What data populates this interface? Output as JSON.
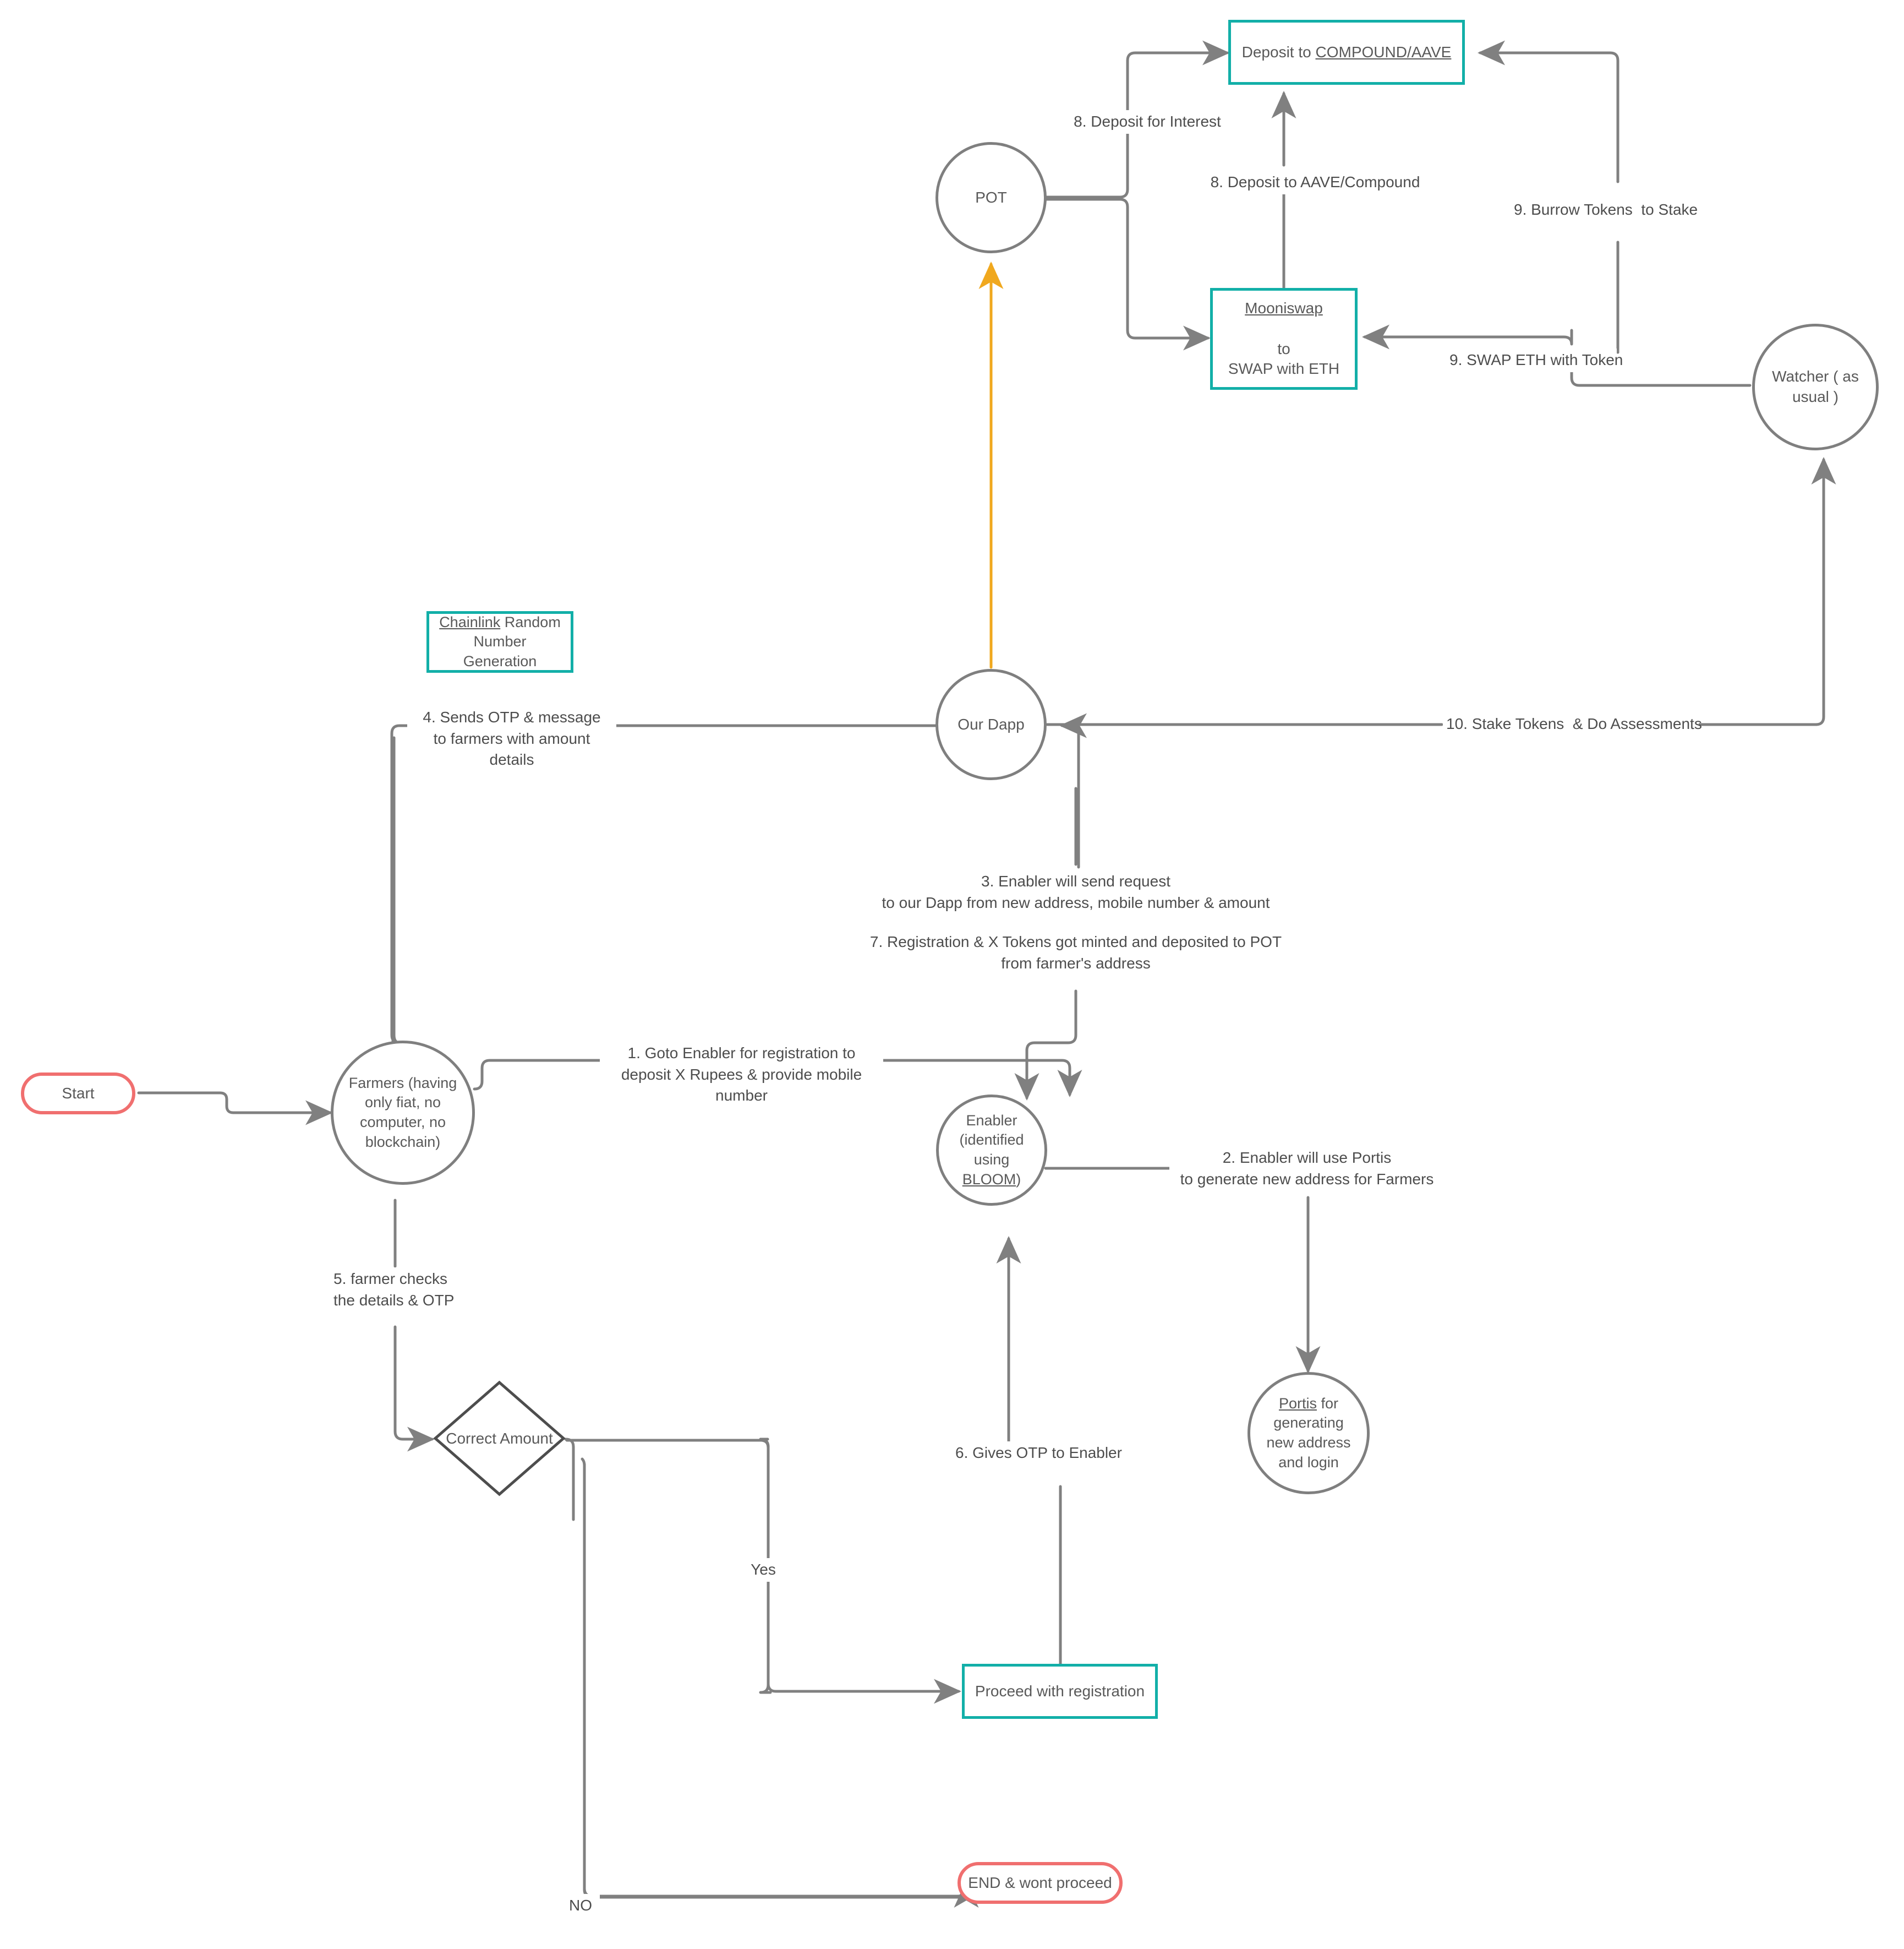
{
  "diagram": {
    "title": "Farmer DeFi onboarding flowchart",
    "colors": {
      "teal": "#12AFA8",
      "red": "#F06F6F",
      "gray_line": "#7f7f7f",
      "orange_line": "#F0A81E",
      "text": "#595959"
    }
  },
  "nodes": {
    "start": {
      "label": "Start",
      "shape": "stadium",
      "color": "#F06F6F"
    },
    "farmers": {
      "label": "Farmers (having\nonly fiat, no\ncomputer, no\nblockchain)",
      "shape": "circle"
    },
    "enabler": {
      "label_line1": "Enabler",
      "label_line2": "(identified",
      "label_line3_pre": "using ",
      "label_line3_link": "BLOOM",
      "label_line3_post": ")",
      "shape": "circle"
    },
    "portis": {
      "label_link": "Portis",
      "label_rest": " for\ngenerating\nnew address\nand login",
      "shape": "circle"
    },
    "our_dapp": {
      "label": "Our Dapp",
      "shape": "circle"
    },
    "pot": {
      "label": "POT",
      "shape": "circle"
    },
    "watcher": {
      "label": "Watcher ( as\nusual  )",
      "shape": "circle"
    },
    "chainlink": {
      "label_link": "Chainlink",
      "label_rest": " Random\nNumber\nGeneration",
      "shape": "rect",
      "color": "#12AFA8"
    },
    "mooniswap": {
      "label_link": "Mooniswap",
      "label_rest": "\nto\nSWAP with ETH",
      "shape": "rect",
      "color": "#12AFA8"
    },
    "deposit_compound": {
      "label_pre": "Deposit to ",
      "label_link": "COMPOUND/AAVE",
      "shape": "rect",
      "color": "#12AFA8"
    },
    "correct_amount": {
      "label": "Correct Amount",
      "shape": "diamond"
    },
    "proceed": {
      "label": "Proceed with registration",
      "shape": "rect",
      "color": "#12AFA8"
    },
    "end": {
      "label": "END & wont proceed",
      "shape": "stadium",
      "color": "#F06F6F"
    }
  },
  "edge_labels": {
    "step1": "1. Goto Enabler for registration to\ndeposit X Rupees & provide mobile number",
    "step2": "2. Enabler will use Portis\nto generate new address for Farmers",
    "step3": "3. Enabler will send request\nto our Dapp from new address, mobile number & amount",
    "step4": "4. Sends OTP & message\nto farmers with amount details",
    "step5": "5. farmer checks\nthe details & OTP",
    "step6": "6. Gives OTP to Enabler",
    "step7": "7. Registration & X Tokens  got minted and deposited to POT\nfrom farmer's address",
    "step8a": "8. Deposit for Interest",
    "step8b": "8. Deposit to AAVE/Compound",
    "step9a": "9. Burrow Tokens  to Stake",
    "step9b": "9. SWAP ETH with Token",
    "step10": "10. Stake Tokens  & Do Assessments",
    "yes": "Yes",
    "no": "NO"
  }
}
